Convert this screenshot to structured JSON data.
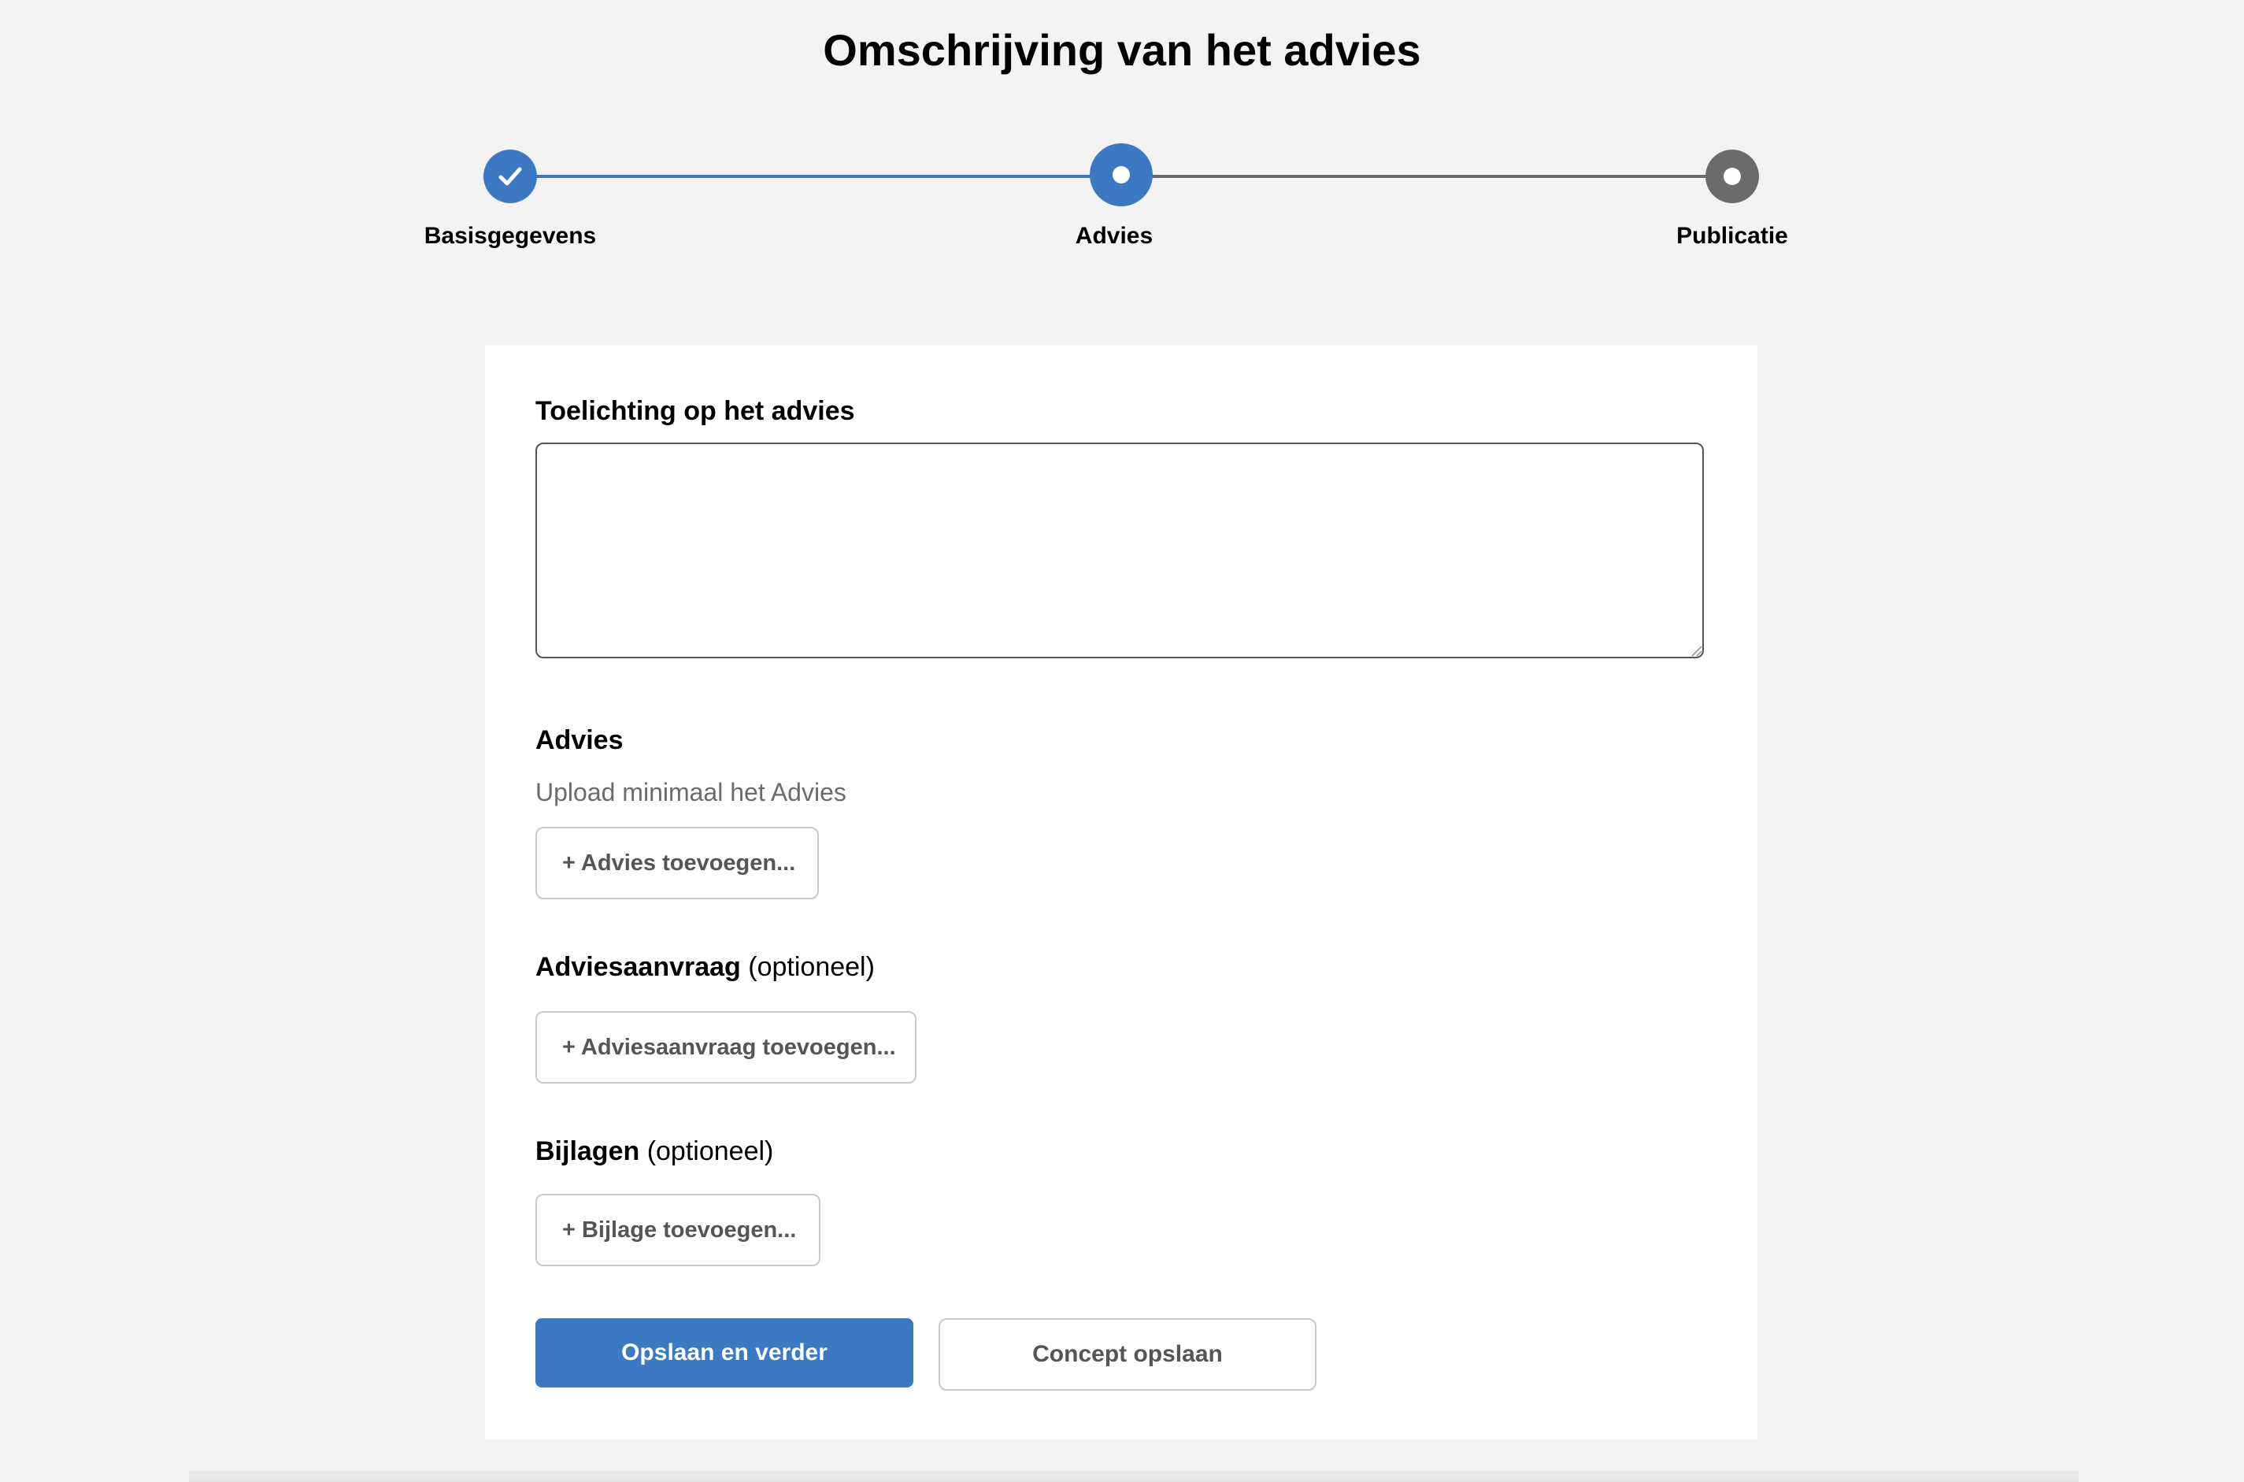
{
  "page": {
    "title": "Omschrijving van het advies"
  },
  "stepper": {
    "steps": [
      {
        "label": "Basisgegevens",
        "status": "completed"
      },
      {
        "label": "Advies",
        "status": "current"
      },
      {
        "label": "Publicatie",
        "status": "upcoming"
      }
    ],
    "colors": {
      "active": "#3b79c3",
      "inactive": "#6b6b6b"
    }
  },
  "form": {
    "toelichting": {
      "label": "Toelichting op het advies",
      "value": ""
    },
    "advies": {
      "label": "Advies",
      "hint": "Upload minimaal het Advies",
      "button_label": "+ Advies toevoegen..."
    },
    "adviesaanvraag": {
      "label": "Adviesaanvraag",
      "optional_label": "(optioneel)",
      "button_label": "+ Adviesaanvraag toevoegen..."
    },
    "bijlagen": {
      "label": "Bijlagen",
      "optional_label": "(optioneel)",
      "button_label": "+ Bijlage toevoegen..."
    },
    "actions": {
      "primary_label": "Opslaan en verder",
      "secondary_label": "Concept opslaan"
    }
  }
}
